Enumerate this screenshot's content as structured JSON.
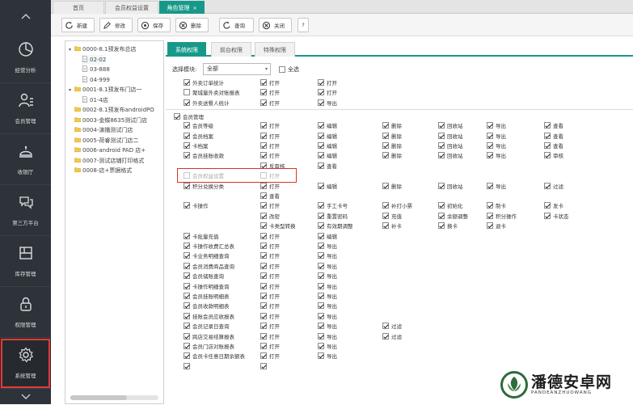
{
  "nav": {
    "items": [
      {
        "label": "经营分析",
        "icon": "pie-chart-icon"
      },
      {
        "label": "会员管理",
        "icon": "member-list-icon"
      },
      {
        "label": "收银厅",
        "icon": "service-bell-icon"
      },
      {
        "label": "第三方平台",
        "icon": "chat-bubbles-icon"
      },
      {
        "label": "库存管理",
        "icon": "inventory-icon"
      },
      {
        "label": "权限管理",
        "icon": "lock-icon"
      },
      {
        "label": "系统管理",
        "icon": "gear-icon"
      }
    ],
    "active_index": 6
  },
  "tabs": [
    {
      "label": "首页"
    },
    {
      "label": "会员权益设置"
    },
    {
      "label": "角色管理",
      "close": "×"
    }
  ],
  "toolbar": {
    "new": "新建",
    "edit": "修改",
    "save": "保存",
    "delete": "删除",
    "query": "查询",
    "close": "关闭",
    "help": "?"
  },
  "tree": [
    {
      "label": "0000-8.1预发布总店",
      "level": 0,
      "toggle": "▾",
      "kind": "folder"
    },
    {
      "label": "02-02",
      "level": 1,
      "kind": "doc"
    },
    {
      "label": "03-888",
      "level": 1,
      "kind": "doc"
    },
    {
      "label": "04-999",
      "level": 1,
      "kind": "doc"
    },
    {
      "label": "0001-8.1预发布门店一",
      "level": 0,
      "toggle": "▾",
      "kind": "folder"
    },
    {
      "label": "01-4店",
      "level": 1,
      "kind": "doc"
    },
    {
      "label": "0002-8.1预发布androidPO",
      "level": 0,
      "kind": "folder"
    },
    {
      "label": "0003-金蝶8635测试门店",
      "level": 0,
      "kind": "folder"
    },
    {
      "label": "0004-演播测试门店",
      "level": 0,
      "kind": "folder"
    },
    {
      "label": "0005-荷睿测试门店二",
      "level": 0,
      "kind": "folder"
    },
    {
      "label": "0006-android PAD 店+",
      "level": 0,
      "kind": "folder"
    },
    {
      "label": "0007-测试店铺打印格式",
      "level": 0,
      "kind": "folder"
    },
    {
      "label": "0008-店+票据格式",
      "level": 0,
      "kind": "folder"
    }
  ],
  "perm_tabs": [
    {
      "label": "系统权限"
    },
    {
      "label": "前台权限"
    },
    {
      "label": "特殊权限"
    }
  ],
  "filter": {
    "label": "选择模块:",
    "value": "全部",
    "caret": "▾",
    "all_label": "全选"
  },
  "perms": [
    {
      "label": "外卖订单统计",
      "checked": true,
      "ops": [
        {
          "label": "打开",
          "checked": true,
          "col": 1
        },
        {
          "label": "打开",
          "checked": true,
          "col": 2
        }
      ]
    },
    {
      "label": "聚城量外卖对账报表",
      "checked": false,
      "ops": [
        {
          "label": "打开",
          "checked": true,
          "col": 1
        },
        {
          "label": "打开",
          "checked": true,
          "col": 2
        }
      ]
    },
    {
      "label": "外卖送餐人统计",
      "checked": true,
      "ops": [
        {
          "label": "打开",
          "checked": true,
          "col": 1
        },
        {
          "label": "导出",
          "checked": true,
          "col": 2
        }
      ]
    },
    {
      "section": "会员管理",
      "checked": true
    },
    {
      "label": "会员等级",
      "checked": true,
      "ops": [
        {
          "label": "打开",
          "checked": true,
          "col": 1
        },
        {
          "label": "编辑",
          "checked": true,
          "col": 2
        },
        {
          "label": "删除",
          "checked": true,
          "col": 3
        },
        {
          "label": "回收站",
          "checked": true,
          "col": 4
        },
        {
          "label": "导出",
          "checked": true,
          "col": 5
        },
        {
          "label": "查看",
          "checked": true,
          "col": 6
        }
      ]
    },
    {
      "label": "会员档案",
      "checked": true,
      "ops": [
        {
          "label": "打开",
          "checked": true,
          "col": 1
        },
        {
          "label": "编辑",
          "checked": true,
          "col": 2
        },
        {
          "label": "删除",
          "checked": true,
          "col": 3
        },
        {
          "label": "回收站",
          "checked": true,
          "col": 4
        },
        {
          "label": "导出",
          "checked": true,
          "col": 5
        },
        {
          "label": "查看",
          "checked": true,
          "col": 6
        }
      ]
    },
    {
      "label": "卡档案",
      "checked": true,
      "ops": [
        {
          "label": "打开",
          "checked": true,
          "col": 1
        },
        {
          "label": "编辑",
          "checked": true,
          "col": 2
        },
        {
          "label": "删除",
          "checked": true,
          "col": 3
        },
        {
          "label": "回收站",
          "checked": true,
          "col": 4
        },
        {
          "label": "导出",
          "checked": true,
          "col": 5
        },
        {
          "label": "查看",
          "checked": true,
          "col": 6
        }
      ]
    },
    {
      "label": "会员挂账收款",
      "checked": true,
      "ops": [
        {
          "label": "打开",
          "checked": true,
          "col": 1
        },
        {
          "label": "编辑",
          "checked": true,
          "col": 2
        },
        {
          "label": "删除",
          "checked": true,
          "col": 3
        },
        {
          "label": "回收站",
          "checked": true,
          "col": 4
        },
        {
          "label": "导出",
          "checked": true,
          "col": 5
        },
        {
          "label": "审核",
          "checked": true,
          "col": 6
        }
      ]
    },
    {
      "label": "",
      "ops": [
        {
          "label": "反审核",
          "checked": true,
          "col": 1
        },
        {
          "label": "查看",
          "checked": true,
          "col": 2
        }
      ]
    },
    {
      "label": "会员权益设置",
      "checked": false,
      "dim": true,
      "highlight": true,
      "ops": [
        {
          "label": "打开",
          "checked": false,
          "col": 1,
          "dim": true
        }
      ]
    },
    {
      "label": "积分兑换分类",
      "checked": true,
      "ops": [
        {
          "label": "打开",
          "checked": true,
          "col": 1
        },
        {
          "label": "编辑",
          "checked": true,
          "col": 2
        },
        {
          "label": "删除",
          "checked": true,
          "col": 3
        },
        {
          "label": "回收站",
          "checked": true,
          "col": 4
        },
        {
          "label": "导出",
          "checked": true,
          "col": 5
        },
        {
          "label": "过滤",
          "checked": true,
          "col": 6
        }
      ]
    },
    {
      "label": "",
      "ops": [
        {
          "label": "查看",
          "checked": true,
          "col": 1
        }
      ]
    },
    {
      "label": "卡操作",
      "checked": true,
      "ops": [
        {
          "label": "打开",
          "checked": true,
          "col": 1
        },
        {
          "label": "手工卡号",
          "checked": true,
          "col": 2
        },
        {
          "label": "补打小票",
          "checked": true,
          "col": 3
        },
        {
          "label": "初始化",
          "checked": true,
          "col": 4
        },
        {
          "label": "制卡",
          "checked": true,
          "col": 5
        },
        {
          "label": "发卡",
          "checked": true,
          "col": 6
        }
      ]
    },
    {
      "label": "",
      "ops": [
        {
          "label": "改密",
          "checked": true,
          "col": 1
        },
        {
          "label": "重置密码",
          "checked": true,
          "col": 2
        },
        {
          "label": "充值",
          "checked": true,
          "col": 3
        },
        {
          "label": "余额调整",
          "checked": true,
          "col": 4
        },
        {
          "label": "积分操作",
          "checked": true,
          "col": 5
        },
        {
          "label": "卡状态",
          "checked": true,
          "col": 6
        }
      ]
    },
    {
      "label": "",
      "ops": [
        {
          "label": "卡类型转换",
          "checked": true,
          "col": 1
        },
        {
          "label": "有效期调整",
          "checked": true,
          "col": 2
        },
        {
          "label": "补卡",
          "checked": true,
          "col": 3
        },
        {
          "label": "换卡",
          "checked": true,
          "col": 4
        },
        {
          "label": "退卡",
          "checked": true,
          "col": 5
        }
      ]
    },
    {
      "label": "卡批量充值",
      "checked": true,
      "ops": [
        {
          "label": "打开",
          "checked": true,
          "col": 1
        },
        {
          "label": "编辑",
          "checked": true,
          "col": 2
        }
      ]
    },
    {
      "label": "卡操作收费汇总表",
      "checked": true,
      "ops": [
        {
          "label": "打开",
          "checked": true,
          "col": 1
        },
        {
          "label": "导出",
          "checked": true,
          "col": 2
        }
      ]
    },
    {
      "label": "卡业务明细查询",
      "checked": true,
      "ops": [
        {
          "label": "打开",
          "checked": true,
          "col": 1
        },
        {
          "label": "导出",
          "checked": true,
          "col": 2
        }
      ]
    },
    {
      "label": "会员消费商品查询",
      "checked": true,
      "ops": [
        {
          "label": "打开",
          "checked": true,
          "col": 1
        },
        {
          "label": "导出",
          "checked": true,
          "col": 2
        }
      ]
    },
    {
      "label": "会员储账查询",
      "checked": true,
      "ops": [
        {
          "label": "打开",
          "checked": true,
          "col": 1
        },
        {
          "label": "导出",
          "checked": true,
          "col": 2
        }
      ]
    },
    {
      "label": "卡操作明细查询",
      "checked": true,
      "ops": [
        {
          "label": "打开",
          "checked": true,
          "col": 1
        },
        {
          "label": "导出",
          "checked": true,
          "col": 2
        }
      ]
    },
    {
      "label": "会员挂账明细表",
      "checked": true,
      "ops": [
        {
          "label": "打开",
          "checked": true,
          "col": 1
        },
        {
          "label": "导出",
          "checked": true,
          "col": 2
        }
      ]
    },
    {
      "label": "会员收款明细表",
      "checked": true,
      "ops": [
        {
          "label": "打开",
          "checked": true,
          "col": 1
        },
        {
          "label": "导出",
          "checked": true,
          "col": 2
        }
      ]
    },
    {
      "label": "挂账会员应收报表",
      "checked": true,
      "ops": [
        {
          "label": "打开",
          "checked": true,
          "col": 1
        },
        {
          "label": "导出",
          "checked": true,
          "col": 2
        }
      ]
    },
    {
      "label": "会员记录日查询",
      "checked": true,
      "ops": [
        {
          "label": "打开",
          "checked": true,
          "col": 1
        },
        {
          "label": "导出",
          "checked": true,
          "col": 2
        },
        {
          "label": "过滤",
          "checked": true,
          "col": 3
        }
      ]
    },
    {
      "label": "跨店交易结算报表",
      "checked": true,
      "ops": [
        {
          "label": "打开",
          "checked": true,
          "col": 1
        },
        {
          "label": "导出",
          "checked": true,
          "col": 2
        },
        {
          "label": "过滤",
          "checked": true,
          "col": 3
        }
      ]
    },
    {
      "label": "会员门店对账报表",
      "checked": true,
      "ops": [
        {
          "label": "打开",
          "checked": true,
          "col": 1
        },
        {
          "label": "导出",
          "checked": true,
          "col": 2
        }
      ]
    },
    {
      "label": "会员卡任意日期余额表",
      "checked": true,
      "ops": [
        {
          "label": "打开",
          "checked": true,
          "col": 1
        },
        {
          "label": "导出",
          "checked": true,
          "col": 2
        }
      ]
    },
    {
      "label": "",
      "checked": true,
      "ops": [
        {
          "label": "",
          "checked": true,
          "col": 1
        }
      ]
    }
  ],
  "watermark": {
    "title": "潘德安卓网",
    "subtitle": "PANDEANZHUOWANG"
  }
}
